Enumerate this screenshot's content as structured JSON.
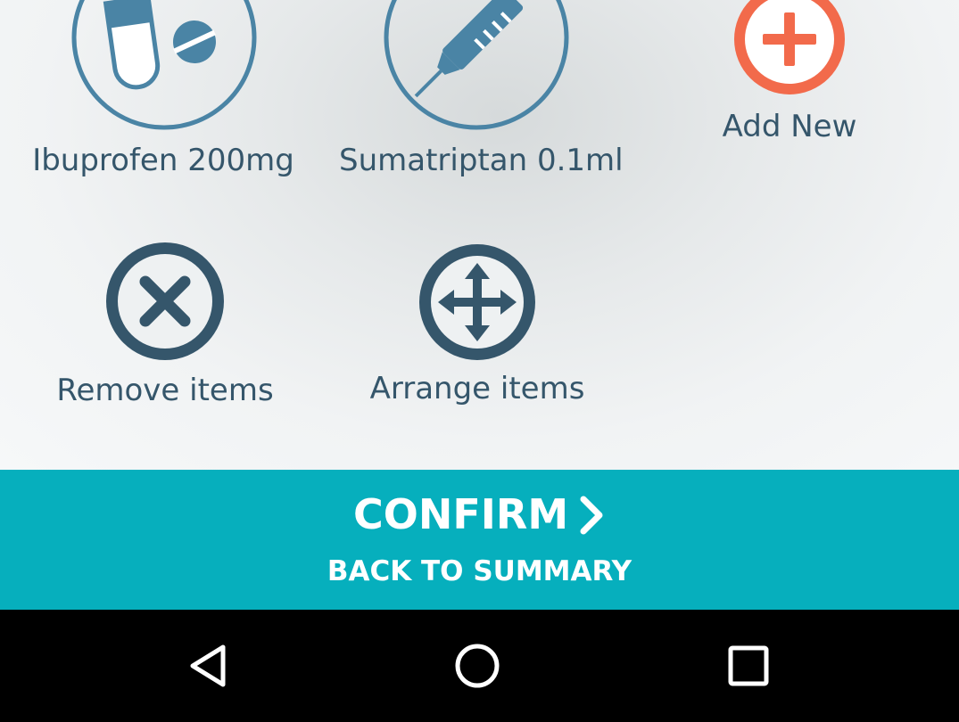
{
  "colors": {
    "text_primary": "#35566b",
    "icon_stroke": "#35566b",
    "medicine_icon": "#4a84a5",
    "add_accent": "#f26a4b",
    "confirm_bar": "#06afbd",
    "nav_bar": "#000000"
  },
  "medications": [
    {
      "label": "Ibuprofen 200mg",
      "icon": "pill-capsule-icon"
    },
    {
      "label": "Sumatriptan 0.1ml",
      "icon": "syringe-icon"
    }
  ],
  "actions": {
    "add_new": {
      "label": "Add New",
      "icon": "plus-circle-icon"
    },
    "remove_items": {
      "label": "Remove items",
      "icon": "close-circle-icon"
    },
    "arrange_items": {
      "label": "Arrange items",
      "icon": "move-arrows-icon"
    }
  },
  "footer": {
    "confirm_label": "CONFIRM",
    "confirm_icon": "chevron-right-icon",
    "back_label": "BACK TO SUMMARY"
  },
  "navigation": {
    "back_icon": "back-triangle-icon",
    "home_icon": "home-circle-icon",
    "recents_icon": "recents-square-icon"
  }
}
